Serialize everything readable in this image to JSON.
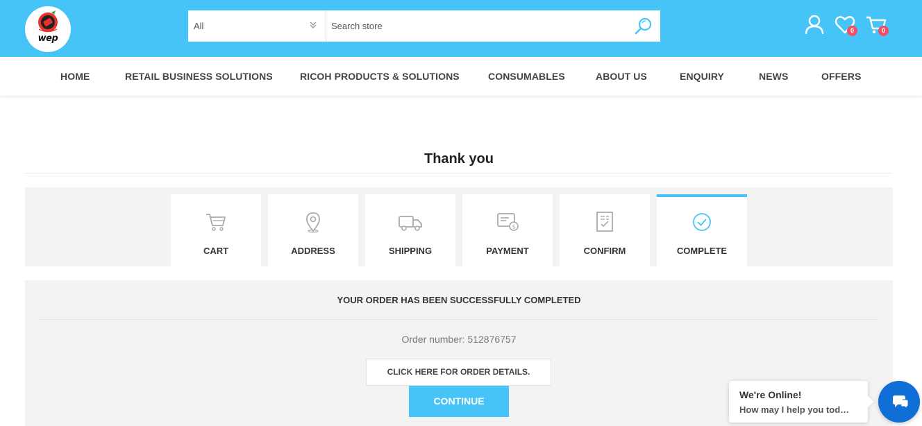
{
  "brand": {
    "logo_text": "wep",
    "accent_color": "#46c4f7"
  },
  "search": {
    "category_value": "All",
    "placeholder": "Search store"
  },
  "header": {
    "wishlist_count": "0",
    "cart_count": "0"
  },
  "nav": {
    "items": [
      {
        "label": "HOME"
      },
      {
        "label": "RETAIL BUSINESS SOLUTIONS"
      },
      {
        "label": "RICOH PRODUCTS & SOLUTIONS"
      },
      {
        "label": "CONSUMABLES"
      },
      {
        "label": "ABOUT US"
      },
      {
        "label": "ENQUIRY"
      },
      {
        "label": "NEWS"
      },
      {
        "label": "OFFERS"
      }
    ]
  },
  "page": {
    "title": "Thank you"
  },
  "steps": [
    {
      "label": "CART",
      "icon": "cart-icon"
    },
    {
      "label": "ADDRESS",
      "icon": "map-pin-icon"
    },
    {
      "label": "SHIPPING",
      "icon": "truck-icon"
    },
    {
      "label": "PAYMENT",
      "icon": "payment-card-icon"
    },
    {
      "label": "CONFIRM",
      "icon": "document-check-icon"
    },
    {
      "label": "COMPLETE",
      "icon": "check-circle-icon",
      "active": true
    }
  ],
  "order": {
    "heading": "YOUR ORDER HAS BEEN SUCCESSFULLY COMPLETED",
    "number_text": "Order number: 512876757",
    "details_label": "CLICK HERE FOR ORDER DETAILS.",
    "continue_label": "CONTINUE"
  },
  "chat": {
    "title": "We're Online!",
    "subtitle": "How may I help you tod…"
  }
}
